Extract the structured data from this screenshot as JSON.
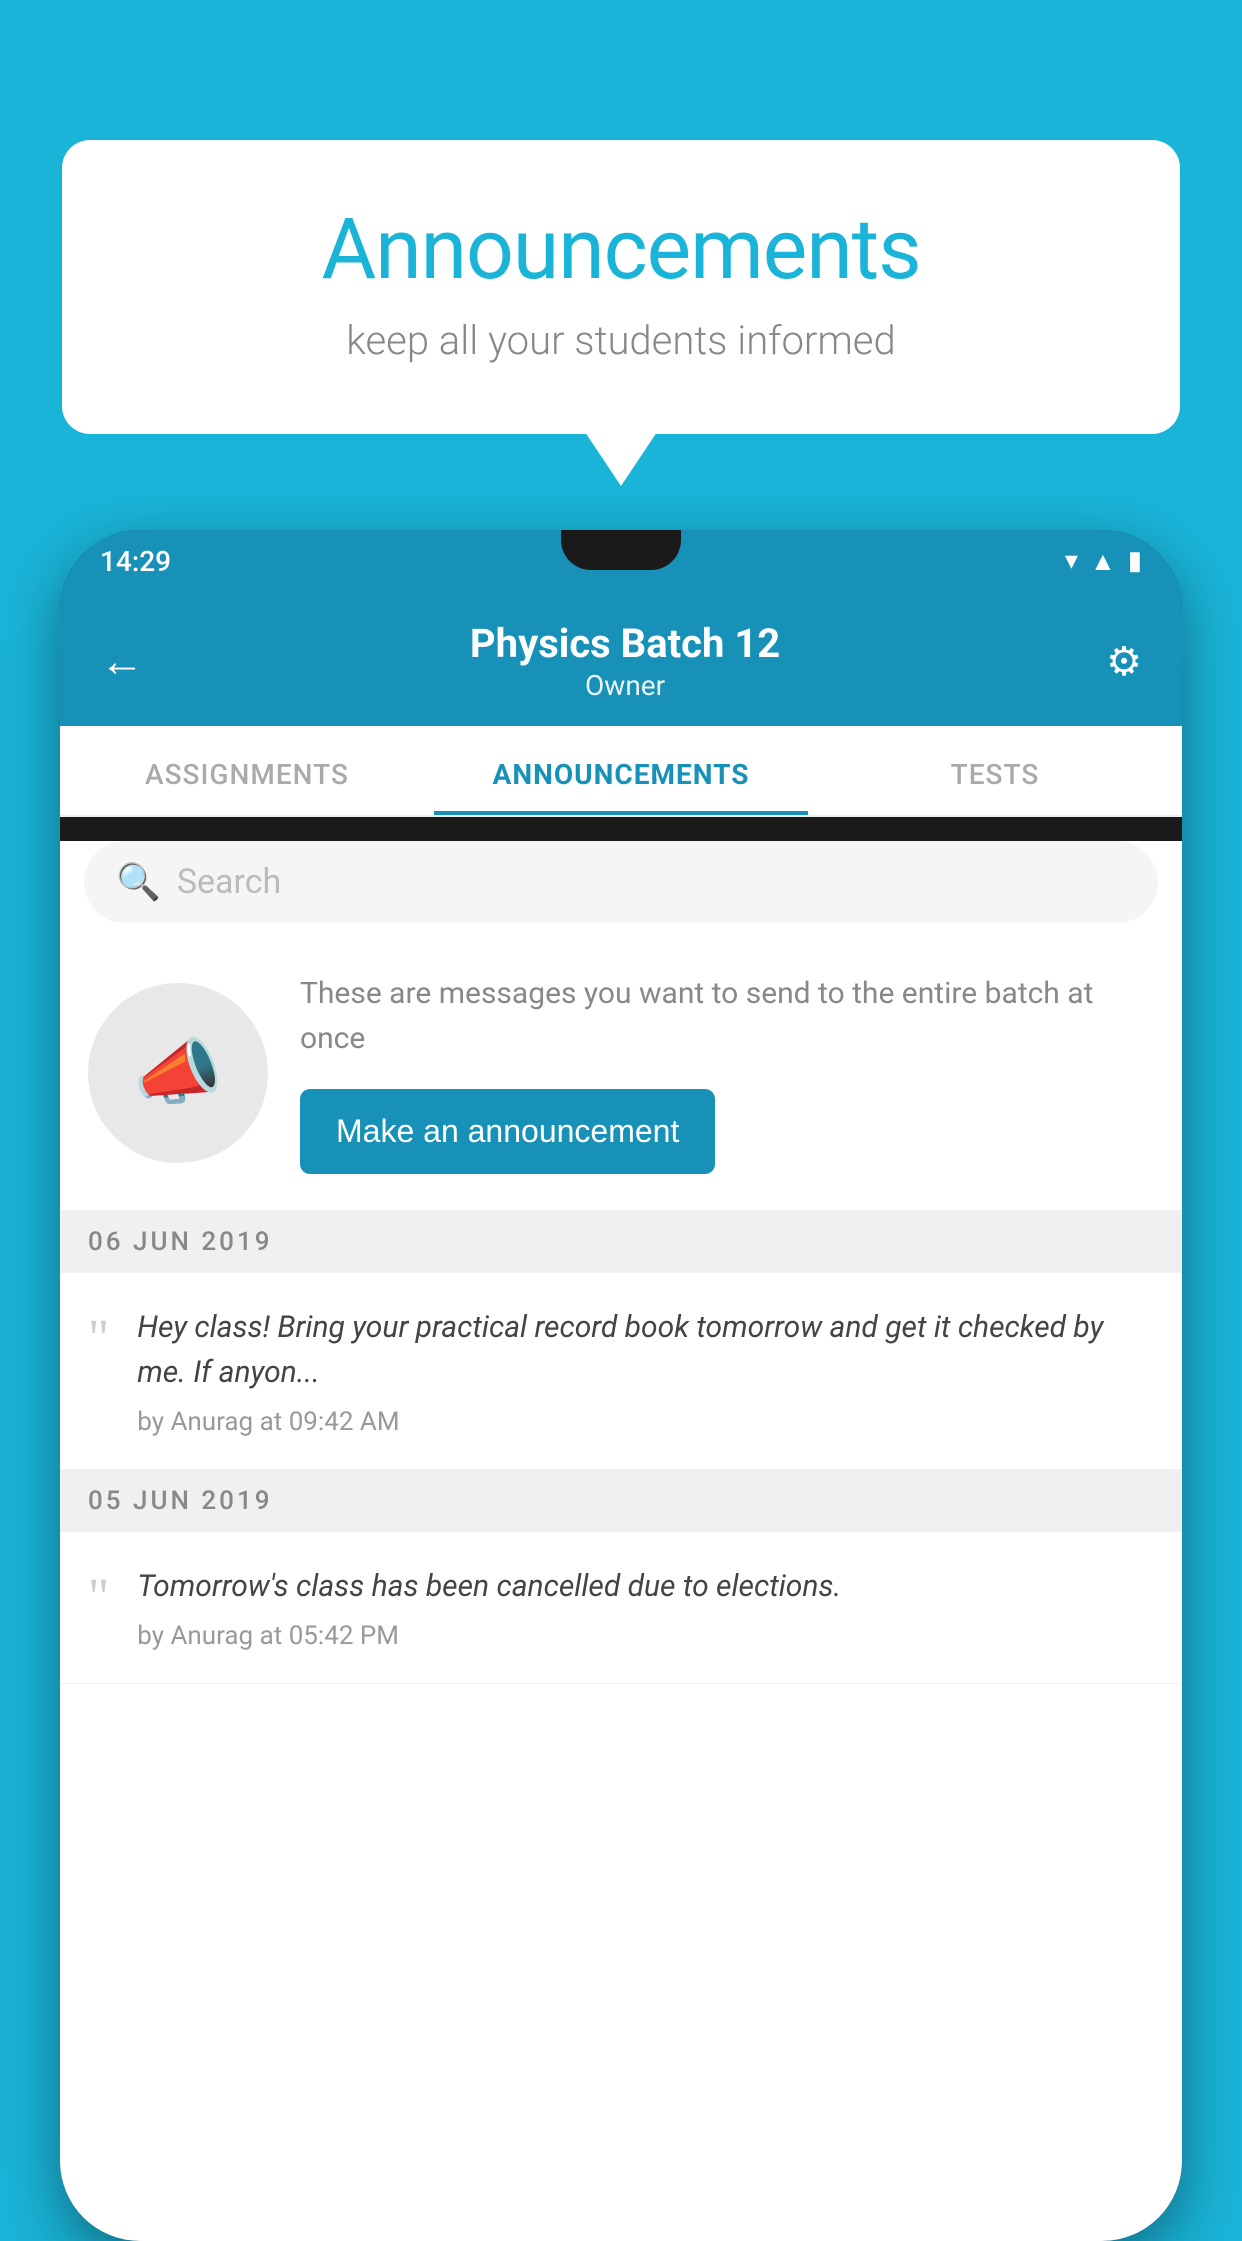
{
  "background_color": "#1ab4d8",
  "speech_bubble": {
    "title": "Announcements",
    "subtitle": "keep all your students informed"
  },
  "phone": {
    "status_bar": {
      "time": "14:29"
    },
    "header": {
      "title": "Physics Batch 12",
      "subtitle": "Owner",
      "back_label": "←",
      "gear_label": "⚙"
    },
    "tabs": [
      {
        "label": "ASSIGNMENTS",
        "active": false
      },
      {
        "label": "ANNOUNCEMENTS",
        "active": true
      },
      {
        "label": "TESTS",
        "active": false
      }
    ],
    "search": {
      "placeholder": "Search"
    },
    "promo": {
      "description": "These are messages you want to send to the entire batch at once",
      "button_label": "Make an announcement"
    },
    "announcements": [
      {
        "date": "06  JUN  2019",
        "message": "Hey class! Bring your practical record book tomorrow and get it checked by me. If anyon...",
        "meta": "by Anurag at 09:42 AM"
      },
      {
        "date": "05  JUN  2019",
        "message": "Tomorrow's class has been cancelled due to elections.",
        "meta": "by Anurag at 05:42 PM"
      }
    ]
  }
}
